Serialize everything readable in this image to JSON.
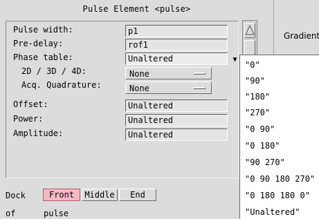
{
  "dialog": {
    "title": "Pulse Element <pulse>"
  },
  "form": {
    "pulse_width": {
      "label": "Pulse width:",
      "value": "p1"
    },
    "pre_delay": {
      "label": "Pre-delay:",
      "value": "rof1"
    },
    "phase_table": {
      "label": "Phase table:",
      "value": "Unaltered"
    },
    "dimension": {
      "label": "2D / 3D / 4D:",
      "value": "None"
    },
    "acq_quadrature": {
      "label": "Acq. Quadrature:",
      "value": "None"
    },
    "offset": {
      "label": "Offset:",
      "value": "Unaltered"
    },
    "power": {
      "label": "Power:",
      "value": "Unaltered"
    },
    "amplitude": {
      "label": "Amplitude:",
      "value": "Unaltered"
    }
  },
  "side": {
    "gradient_label": "Gradient"
  },
  "phase_dropdown": {
    "options": [
      "\"0\"",
      "\"90\"",
      "\"180\"",
      "\"270\"",
      "\"0 90\"",
      "\"0 180\"",
      "\"90 270\"",
      "\"0 90 180 270\"",
      "\"0 180 180 0\"",
      "\"Unaltered\""
    ]
  },
  "dock": {
    "label": "Dock",
    "buttons": [
      "Front",
      "Middle",
      "End"
    ],
    "active": "Front"
  },
  "footer": {
    "of_label": "of",
    "target": "pulse"
  },
  "colors": {
    "active_button": "#f5b8c4",
    "background": "#dcdcdc"
  }
}
